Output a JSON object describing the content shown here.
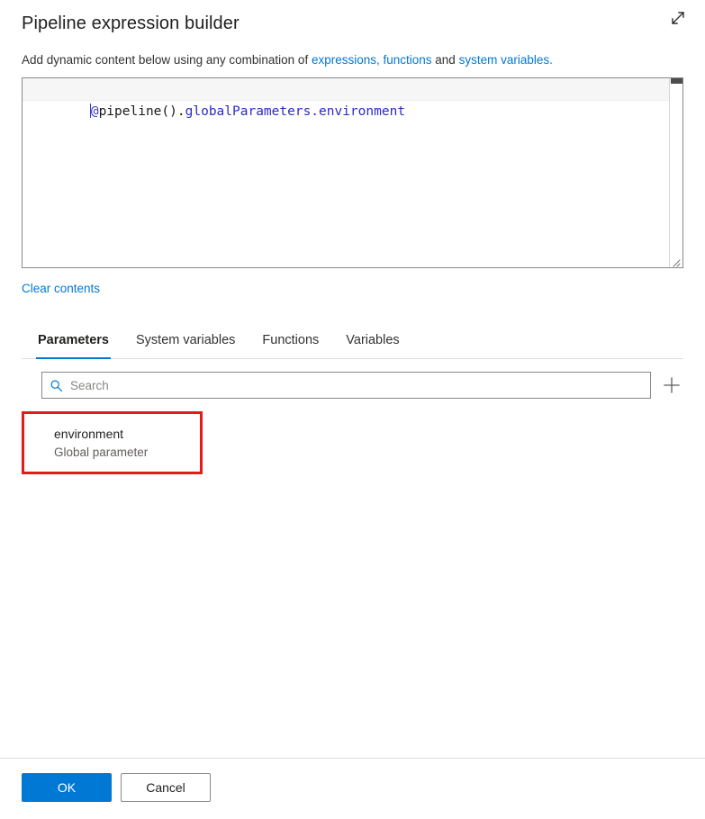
{
  "header": {
    "title": "Pipeline expression builder",
    "expand_icon": "expand-diagonal-icon"
  },
  "subtitle": {
    "prefix": "Add dynamic content below using any combination of ",
    "link_expressions": "expressions, functions",
    "middle": " and ",
    "link_system_variables": "system variables.",
    "link_color": "#0078d4"
  },
  "editor": {
    "expression": "@pipeline().globalParameters.environment",
    "tokens": {
      "at": "@",
      "function": "pipeline",
      "parens": "().",
      "property": "globalParameters.environment"
    },
    "scrollbar_name": "editor-scrollbar",
    "resize_grip": "resize-grip-icon"
  },
  "clear": {
    "label": "Clear contents"
  },
  "tabs": {
    "active": "Parameters",
    "items": [
      {
        "label": "Parameters",
        "active": true
      },
      {
        "label": "System variables",
        "active": false
      },
      {
        "label": "Functions",
        "active": false
      },
      {
        "label": "Variables",
        "active": false
      }
    ],
    "active_color": "#0078d4"
  },
  "search": {
    "value": "",
    "placeholder": "Search",
    "icon": "search-icon",
    "add_icon": "plus-icon"
  },
  "results": {
    "highlight_color": "#e31b1b",
    "items": [
      {
        "name": "environment",
        "subtitle": "Global parameter",
        "highlighted": true
      }
    ]
  },
  "footer": {
    "ok_label": "OK",
    "cancel_label": "Cancel",
    "primary_color": "#0078d4"
  }
}
